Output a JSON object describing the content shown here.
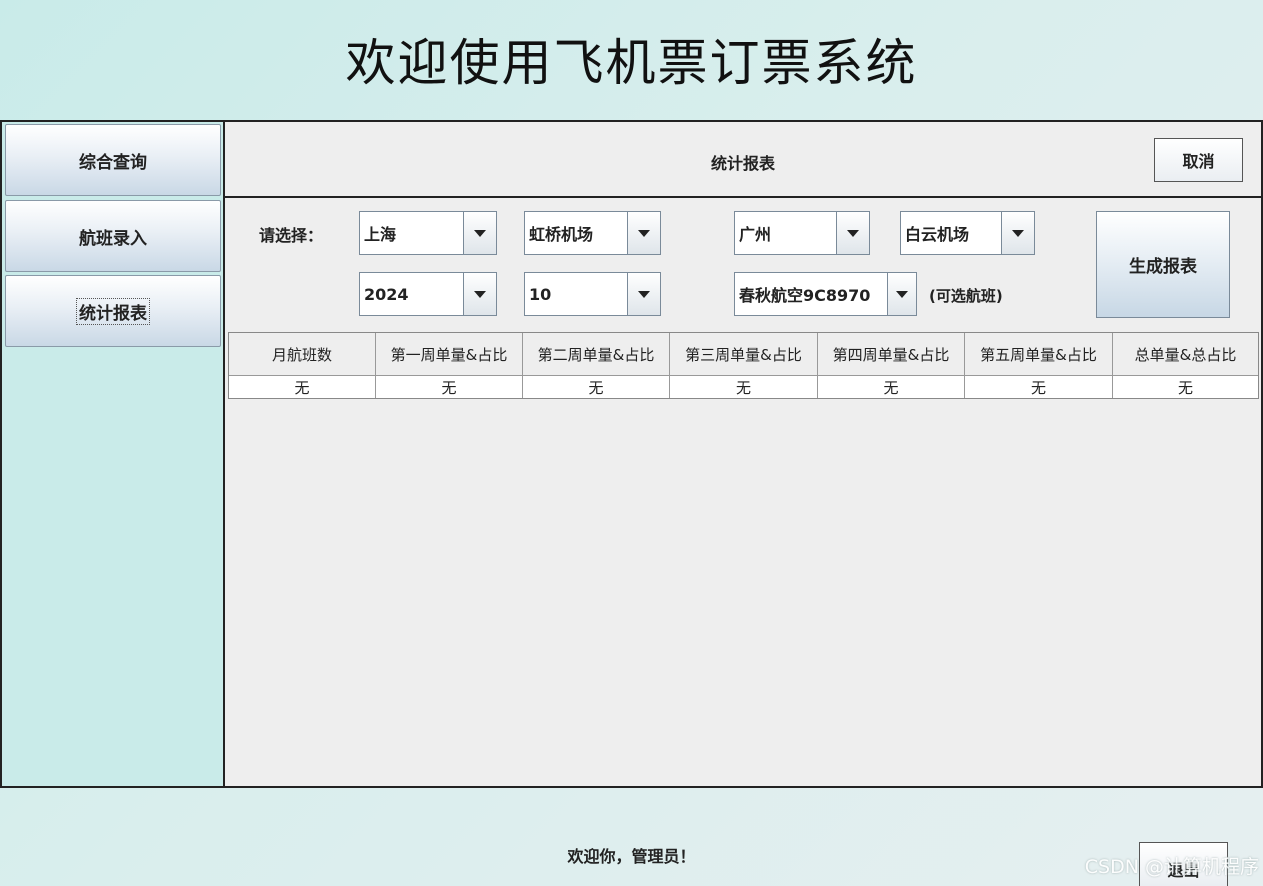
{
  "app": {
    "title": "欢迎使用飞机票订票系统"
  },
  "sidebar": {
    "items": [
      {
        "label": "综合查询"
      },
      {
        "label": "航班录入"
      },
      {
        "label": "统计报表"
      }
    ]
  },
  "panel": {
    "title": "统计报表",
    "cancel_label": "取消",
    "select_label": "请选择：",
    "origin_city": "上海",
    "origin_airport": "虹桥机场",
    "dest_city": "广州",
    "dest_airport": "白云机场",
    "year": "2024",
    "month": "10",
    "flight": "春秋航空9C8970",
    "flight_hint": "(可选航班)",
    "generate_label": "生成报表"
  },
  "table": {
    "headers": [
      "月航班数",
      "第一周单量&占比",
      "第二周单量&占比",
      "第三周单量&占比",
      "第四周单量&占比",
      "第五周单量&占比",
      "总单量&总占比"
    ],
    "rows": [
      [
        "无",
        "无",
        "无",
        "无",
        "无",
        "无",
        "无"
      ]
    ]
  },
  "footer": {
    "welcome": "欢迎你，管理员！",
    "exit_label": "退出",
    "watermark": "CSDN @计算机程序"
  }
}
